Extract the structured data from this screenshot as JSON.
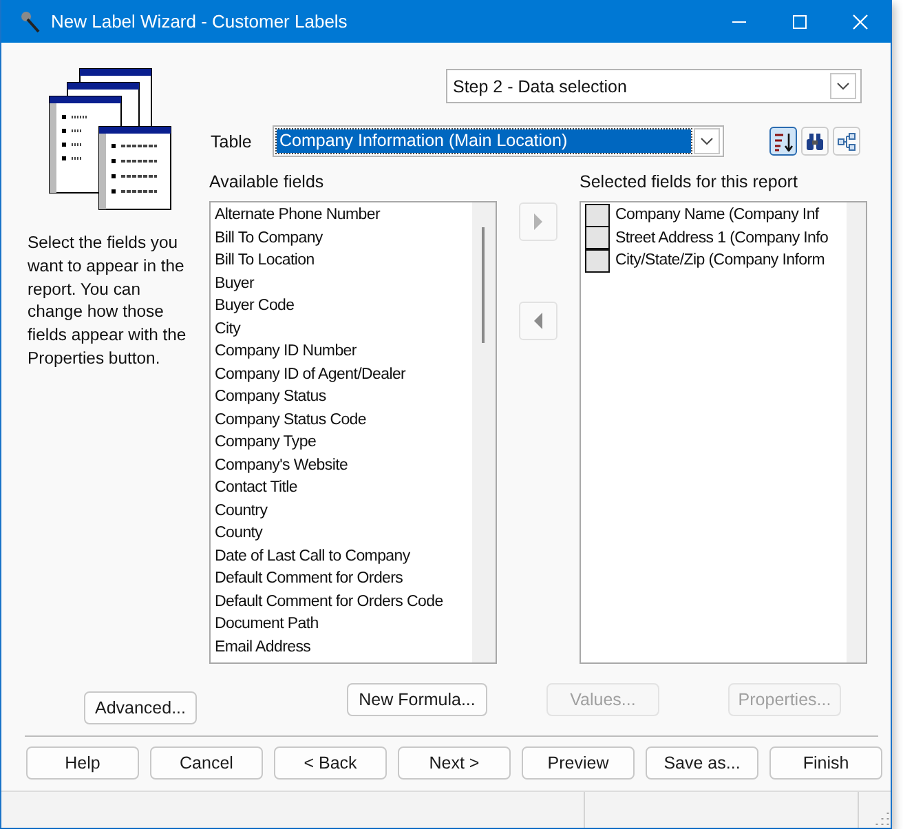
{
  "window": {
    "title": "New Label Wizard - Customer Labels"
  },
  "sidebar": {
    "description": "Select the fields you want to appear in the report. You can change how those fields appear with the Properties button."
  },
  "step_selector": {
    "value": "Step 2 - Data selection"
  },
  "table_selector": {
    "label": "Table",
    "value": "Company Information (Main Location)"
  },
  "toolbar": [
    {
      "kind": "sort",
      "selected": true
    },
    {
      "kind": "find",
      "selected": false
    },
    {
      "kind": "tree",
      "selected": false
    }
  ],
  "available_fields": {
    "label": "Available fields",
    "items": [
      "Alternate Phone Number",
      "Bill To Company",
      "Bill To Location",
      "Buyer",
      "Buyer Code",
      "City",
      "Company ID Number",
      "Company ID of Agent/Dealer",
      "Company Status",
      "Company Status Code",
      "Company Type",
      "Company's Website",
      "Contact Title",
      "Country",
      "County",
      "Date of Last Call to Company",
      "Default Comment for Orders",
      "Default Comment for Orders Code",
      "Document Path",
      "Email Address"
    ]
  },
  "move_buttons": [
    {
      "kind": "add",
      "disabled": true
    },
    {
      "kind": "remove",
      "disabled": false
    }
  ],
  "selected_fields": {
    "label": "Selected fields for this report",
    "items": [
      {
        "text": "Company Name (Company Inf",
        "checked": false
      },
      {
        "text": "Street Address 1 (Company Info",
        "checked": false
      },
      {
        "text": "City/State/Zip (Company Inform",
        "checked": false
      }
    ]
  },
  "field_buttons": [
    {
      "label": "Advanced...",
      "disabled": false
    },
    {
      "label": "New Formula...",
      "disabled": false
    },
    {
      "label": "Values...",
      "disabled": true
    },
    {
      "label": "Properties...",
      "disabled": true
    }
  ],
  "nav_buttons": [
    {
      "label": "Help",
      "disabled": false
    },
    {
      "label": "Cancel",
      "disabled": false
    },
    {
      "label": "< Back",
      "disabled": false
    },
    {
      "label": "Next >",
      "disabled": false
    },
    {
      "label": "Preview",
      "disabled": false
    },
    {
      "label": "Save as...",
      "disabled": false
    },
    {
      "label": "Finish",
      "disabled": false
    }
  ]
}
